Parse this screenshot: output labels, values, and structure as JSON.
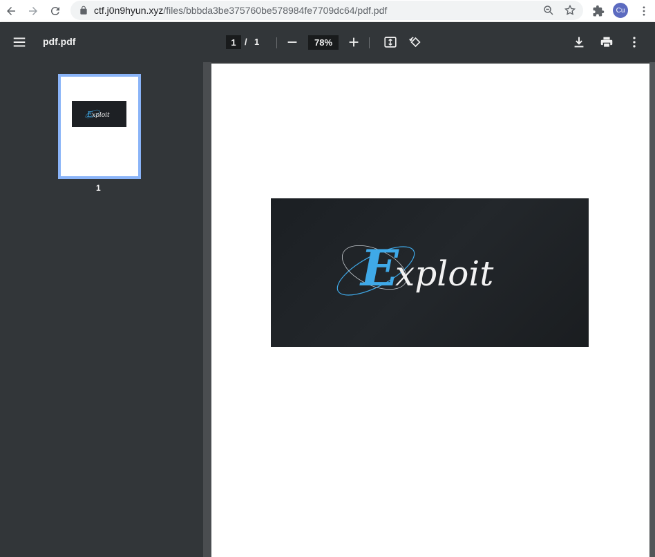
{
  "browser": {
    "url_host": "ctf.j0n9hyun.xyz",
    "url_path": "/files/bbbda3be375760be578984fe7709dc64/pdf.pdf",
    "avatar_initials": "Cu"
  },
  "toolbar": {
    "title": "pdf.pdf",
    "current_page": "1",
    "separator": "/",
    "total_pages": "1",
    "zoom": "78%"
  },
  "sidebar": {
    "thumbnails": [
      {
        "page_label": "1"
      }
    ]
  },
  "document": {
    "logo_text": "Exploit",
    "logo_colors": {
      "accent": "#3fa9e8",
      "text": "#f2f2f2",
      "background": "#1d2024"
    }
  },
  "colors": {
    "toolbar_bg": "#323639",
    "viewer_bg": "#525659",
    "thumbnail_highlight": "#8ab4f8"
  }
}
